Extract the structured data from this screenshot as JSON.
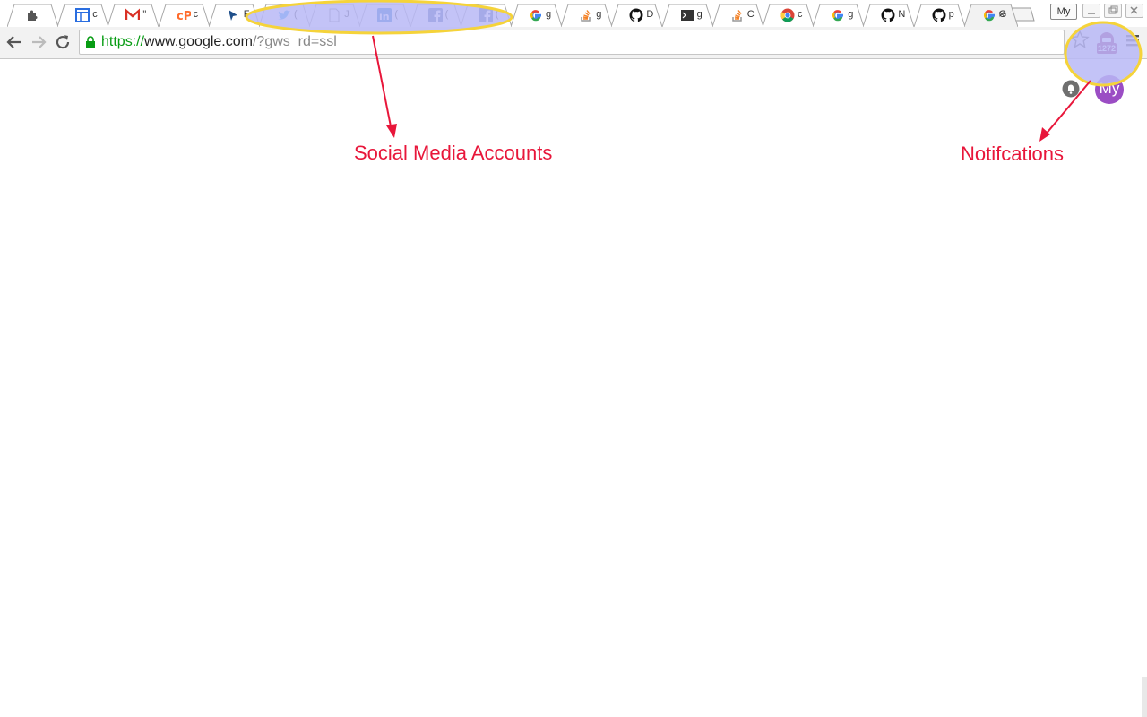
{
  "tabs": [
    {
      "icon": "puzzle-icon",
      "title": ""
    },
    {
      "icon": "calendar-icon",
      "title": "c"
    },
    {
      "icon": "gmail-icon",
      "title": "\""
    },
    {
      "icon": "cpanel-icon",
      "title": "c"
    },
    {
      "icon": "cursor-icon",
      "title": "F"
    },
    {
      "icon": "twitter-icon",
      "title": "("
    },
    {
      "icon": "document-icon",
      "title": "J"
    },
    {
      "icon": "linkedin-icon",
      "title": "("
    },
    {
      "icon": "facebook-icon",
      "title": "("
    },
    {
      "icon": "facebook-icon",
      "title": "("
    },
    {
      "icon": "google-icon",
      "title": "g"
    },
    {
      "icon": "stackoverflow-icon",
      "title": "g"
    },
    {
      "icon": "github-icon",
      "title": "D"
    },
    {
      "icon": "terminal-icon",
      "title": "g"
    },
    {
      "icon": "stackoverflow-icon",
      "title": "C"
    },
    {
      "icon": "chrome-icon",
      "title": "c"
    },
    {
      "icon": "google-icon",
      "title": "g"
    },
    {
      "icon": "github-icon",
      "title": "N"
    },
    {
      "icon": "github-icon",
      "title": "p"
    },
    {
      "icon": "google-icon",
      "title": "G",
      "active": true
    }
  ],
  "profile_badge": "My",
  "omnibox": {
    "scheme": "https://",
    "host": "www.google.com",
    "path": "/?gws_rd=ssl"
  },
  "extension_badge": "1272",
  "account_avatar": "My",
  "annotations": {
    "social": "Social Media Accounts",
    "notifications": "Notifcations"
  },
  "colors": {
    "annotation": "#e8163a",
    "highlight_fill": "#b9b9f6",
    "highlight_stroke": "#f5d33a",
    "url_scheme": "#079c13",
    "avatar": "#9b4dc4"
  }
}
